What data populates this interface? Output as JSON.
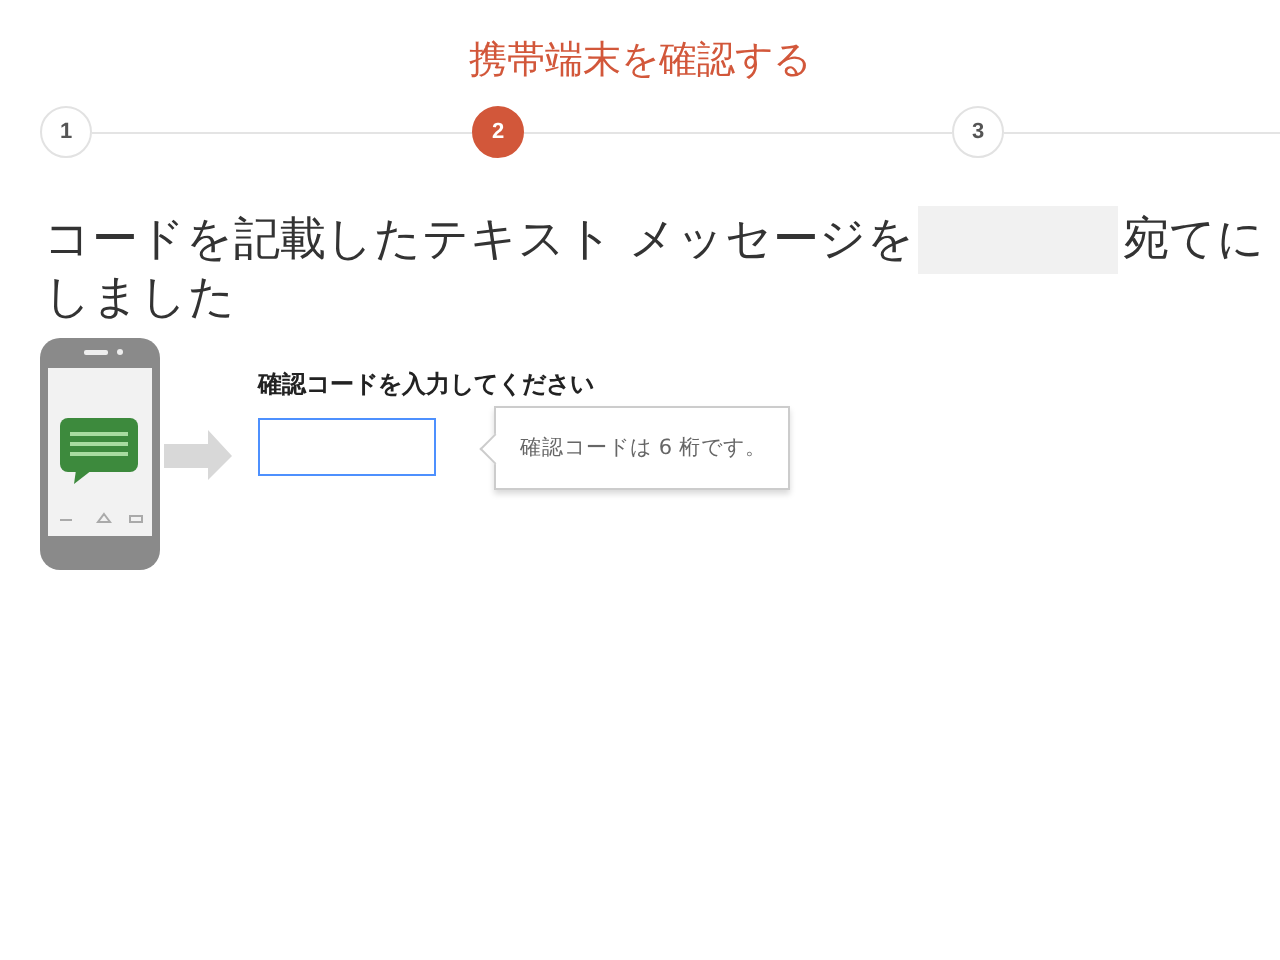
{
  "title": "携帯端末を確認する",
  "steps": [
    {
      "label": "1",
      "selected": false
    },
    {
      "label": "2",
      "selected": true
    },
    {
      "label": "3",
      "selected": false
    }
  ],
  "message": {
    "before": "コードを記載したテキスト メッセージを",
    "after": "宛てに",
    "second_line": "しました"
  },
  "code_field": {
    "label": "確認コードを入力してください"
  },
  "tooltip": "確認コードは 6 桁です。"
}
